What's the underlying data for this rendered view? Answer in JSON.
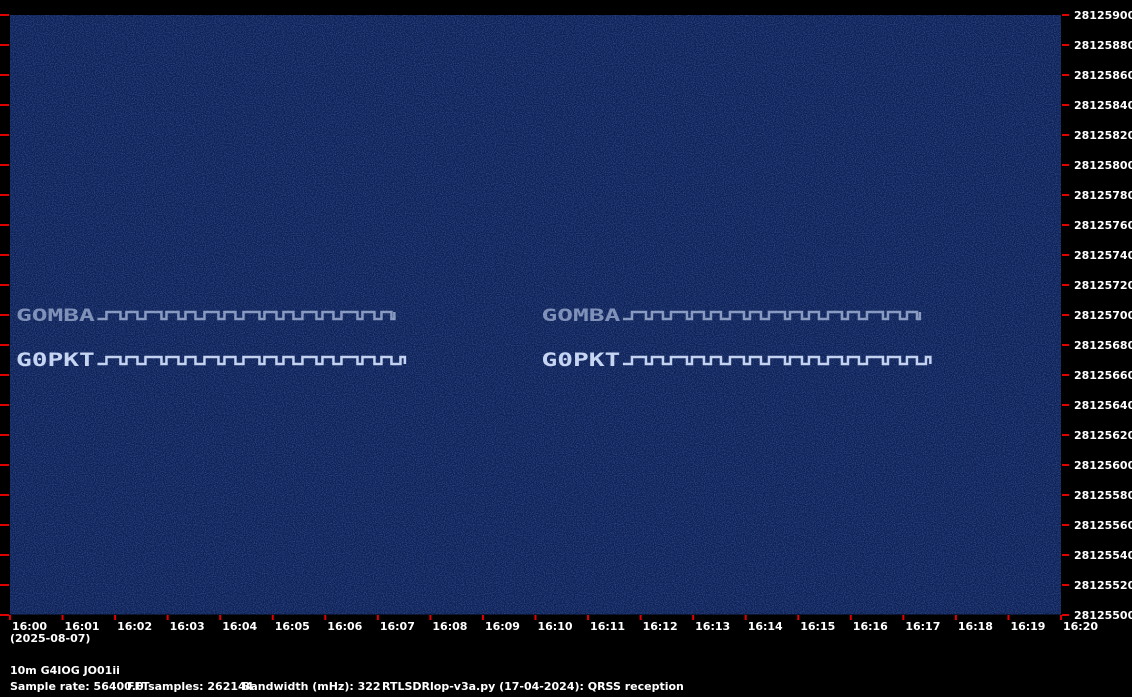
{
  "chart_data": {
    "type": "heatmap",
    "title": "",
    "x_ticks": [
      "16:00",
      "16:01",
      "16:02",
      "16:03",
      "16:04",
      "16:05",
      "16:06",
      "16:07",
      "16:08",
      "16:09",
      "16:10",
      "16:11",
      "16:12",
      "16:13",
      "16:14",
      "16:15",
      "16:16",
      "16:17",
      "16:18",
      "16:19",
      "16:20"
    ],
    "y_ticks": [
      28125900,
      28125880,
      28125860,
      28125840,
      28125820,
      28125800,
      28125780,
      28125760,
      28125740,
      28125720,
      28125700,
      28125680,
      28125660,
      28125640,
      28125620,
      28125600,
      28125580,
      28125560,
      28125540,
      28125520,
      28125500
    ],
    "ylim": [
      28125500,
      28125900
    ],
    "date": "(2025-08-07)",
    "signals": [
      {
        "callsign": "GOMBA",
        "frequency": 28125700,
        "starts": [
          "16:00",
          "16:10"
        ]
      },
      {
        "callsign": "G0PKT",
        "frequency": 28125670,
        "starts": [
          "16:00",
          "16:10"
        ]
      }
    ],
    "colors": {
      "background": "#0d2157",
      "signal": "#d6e4ff",
      "tick": "#e00000"
    }
  },
  "footer": {
    "station": "10m G4IOG JO01ii",
    "sample_rate": "Sample rate: 56400.0",
    "fft_samples": "FFTsamples: 262144",
    "bandwidth": "Bandwidth (mHz): 322",
    "program": "RTLSDRlop-v3a.py (17-04-2024): QRSS reception"
  }
}
